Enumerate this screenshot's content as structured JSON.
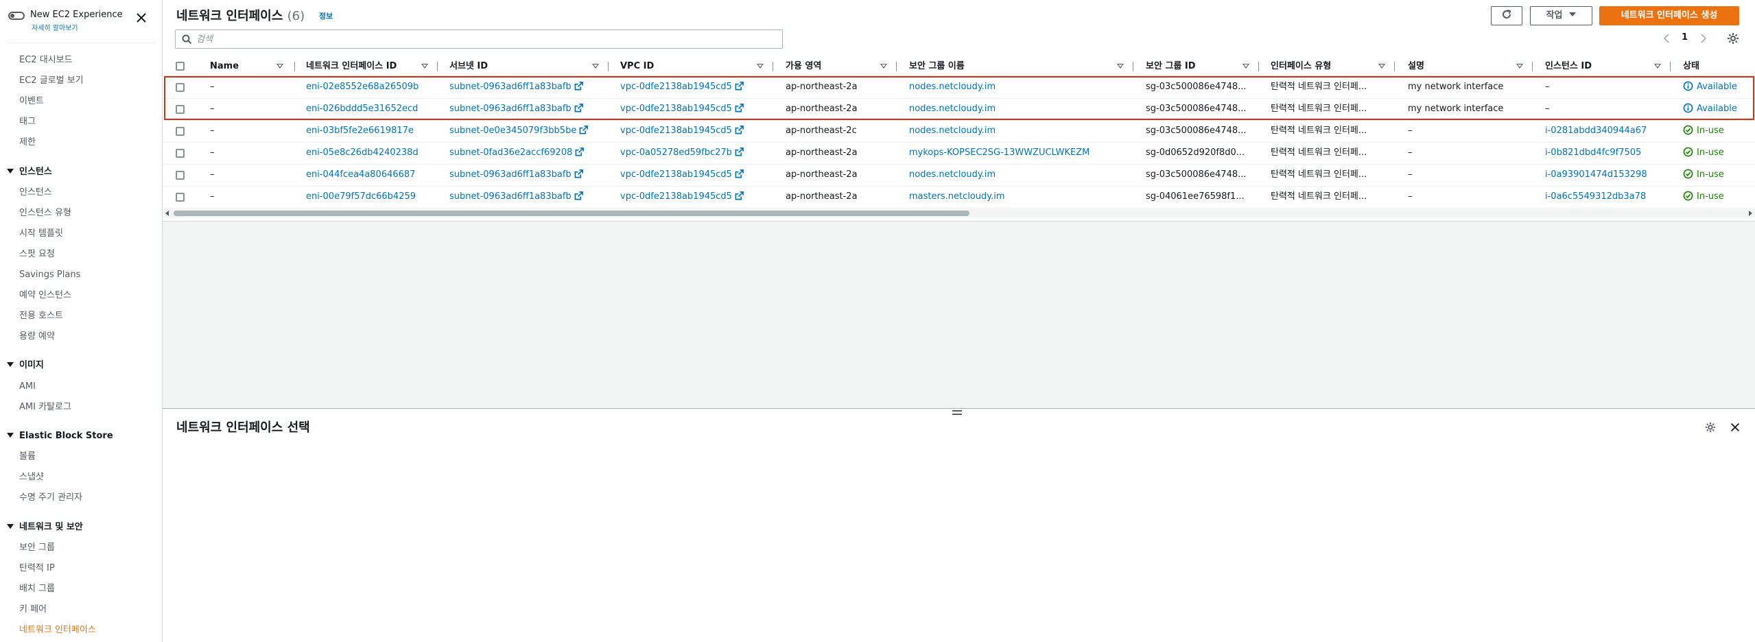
{
  "sidebar": {
    "toggle_label": "New EC2 Experience",
    "toggle_sub": "자세히 알아보기",
    "items_top": [
      "EC2 대시보드",
      "EC2 글로벌 보기",
      "이벤트",
      "태그",
      "제한"
    ],
    "sections": [
      {
        "title": "인스턴스",
        "items": [
          "인스턴스",
          "인스턴스 유형",
          "시작 템플릿",
          "스팟 요청",
          "Savings Plans",
          "예약 인스턴스",
          "전용 호스트",
          "용량 예약"
        ]
      },
      {
        "title": "이미지",
        "items": [
          "AMI",
          "AMI 카탈로그"
        ]
      },
      {
        "title": "Elastic Block Store",
        "items": [
          "볼륨",
          "스냅샷",
          "수명 주기 관리자"
        ]
      },
      {
        "title": "네트워크 및 보안",
        "items": [
          "보안 그룹",
          "탄력적 IP",
          "배치 그룹",
          "키 페어",
          "네트워크 인터페이스"
        ]
      }
    ]
  },
  "header": {
    "title": "네트워크 인터페이스",
    "count": "(6)",
    "info": "정보",
    "actions_label": "작업",
    "create_label": "네트워크 인터페이스 생성"
  },
  "search": {
    "placeholder": "검색",
    "value": ""
  },
  "pagination": {
    "page": "1"
  },
  "table": {
    "columns": [
      "Name",
      "네트워크 인터페이스 ID",
      "서브넷 ID",
      "VPC ID",
      "가용 영역",
      "보안 그룹 이름",
      "보안 그룹 ID",
      "인터페이스 유형",
      "설명",
      "인스턴스 ID",
      "상태"
    ],
    "rows": [
      {
        "name": "–",
        "eni": "eni-02e8552e68a26509b",
        "subnet": "subnet-0963ad6ff1a83bafb",
        "vpc": "vpc-0dfe2138ab1945cd5",
        "az": "ap-northeast-2a",
        "sg_name": "nodes.netcloudy.im",
        "sg_id": "sg-03c500086e4748...",
        "type": "탄력적 네트워크 인터페...",
        "desc": "my network interface",
        "instance": "–",
        "status": "Available"
      },
      {
        "name": "–",
        "eni": "eni-026bddd5e31652ecd",
        "subnet": "subnet-0963ad6ff1a83bafb",
        "vpc": "vpc-0dfe2138ab1945cd5",
        "az": "ap-northeast-2a",
        "sg_name": "nodes.netcloudy.im",
        "sg_id": "sg-03c500086e4748...",
        "type": "탄력적 네트워크 인터페...",
        "desc": "my network interface",
        "instance": "–",
        "status": "Available"
      },
      {
        "name": "–",
        "eni": "eni-03bf5fe2e6619817e",
        "subnet": "subnet-0e0e345079f3bb5be",
        "vpc": "vpc-0dfe2138ab1945cd5",
        "az": "ap-northeast-2c",
        "sg_name": "nodes.netcloudy.im",
        "sg_id": "sg-03c500086e4748...",
        "type": "탄력적 네트워크 인터페...",
        "desc": "–",
        "instance": "i-0281abdd340944a67",
        "status": "In-use"
      },
      {
        "name": "–",
        "eni": "eni-05e8c26db4240238d",
        "subnet": "subnet-0fad36e2accf69208",
        "vpc": "vpc-0a05278ed59fbc27b",
        "az": "ap-northeast-2a",
        "sg_name": "mykops-KOPSEC2SG-13WWZUCLWKEZM",
        "sg_id": "sg-0d0652d920f8d0...",
        "type": "탄력적 네트워크 인터페...",
        "desc": "–",
        "instance": "i-0b821dbd4fc9f7505",
        "status": "In-use"
      },
      {
        "name": "–",
        "eni": "eni-044fcea4a80646687",
        "subnet": "subnet-0963ad6ff1a83bafb",
        "vpc": "vpc-0dfe2138ab1945cd5",
        "az": "ap-northeast-2a",
        "sg_name": "nodes.netcloudy.im",
        "sg_id": "sg-03c500086e4748...",
        "type": "탄력적 네트워크 인터페...",
        "desc": "–",
        "instance": "i-0a93901474d153298",
        "status": "In-use"
      },
      {
        "name": "–",
        "eni": "eni-00e79f57dc66b4259",
        "subnet": "subnet-0963ad6ff1a83bafb",
        "vpc": "vpc-0dfe2138ab1945cd5",
        "az": "ap-northeast-2a",
        "sg_name": "masters.netcloudy.im",
        "sg_id": "sg-04061ee76598f1...",
        "type": "탄력적 네트워크 인터페...",
        "desc": "–",
        "instance": "i-0a6c5549312db3a78",
        "status": "In-use"
      }
    ]
  },
  "detail": {
    "title": "네트워크 인터페이스 선택"
  },
  "colors": {
    "accent": "#ec7211",
    "link": "#0073bb",
    "success": "#1d8102",
    "highlight": "#d13212"
  }
}
